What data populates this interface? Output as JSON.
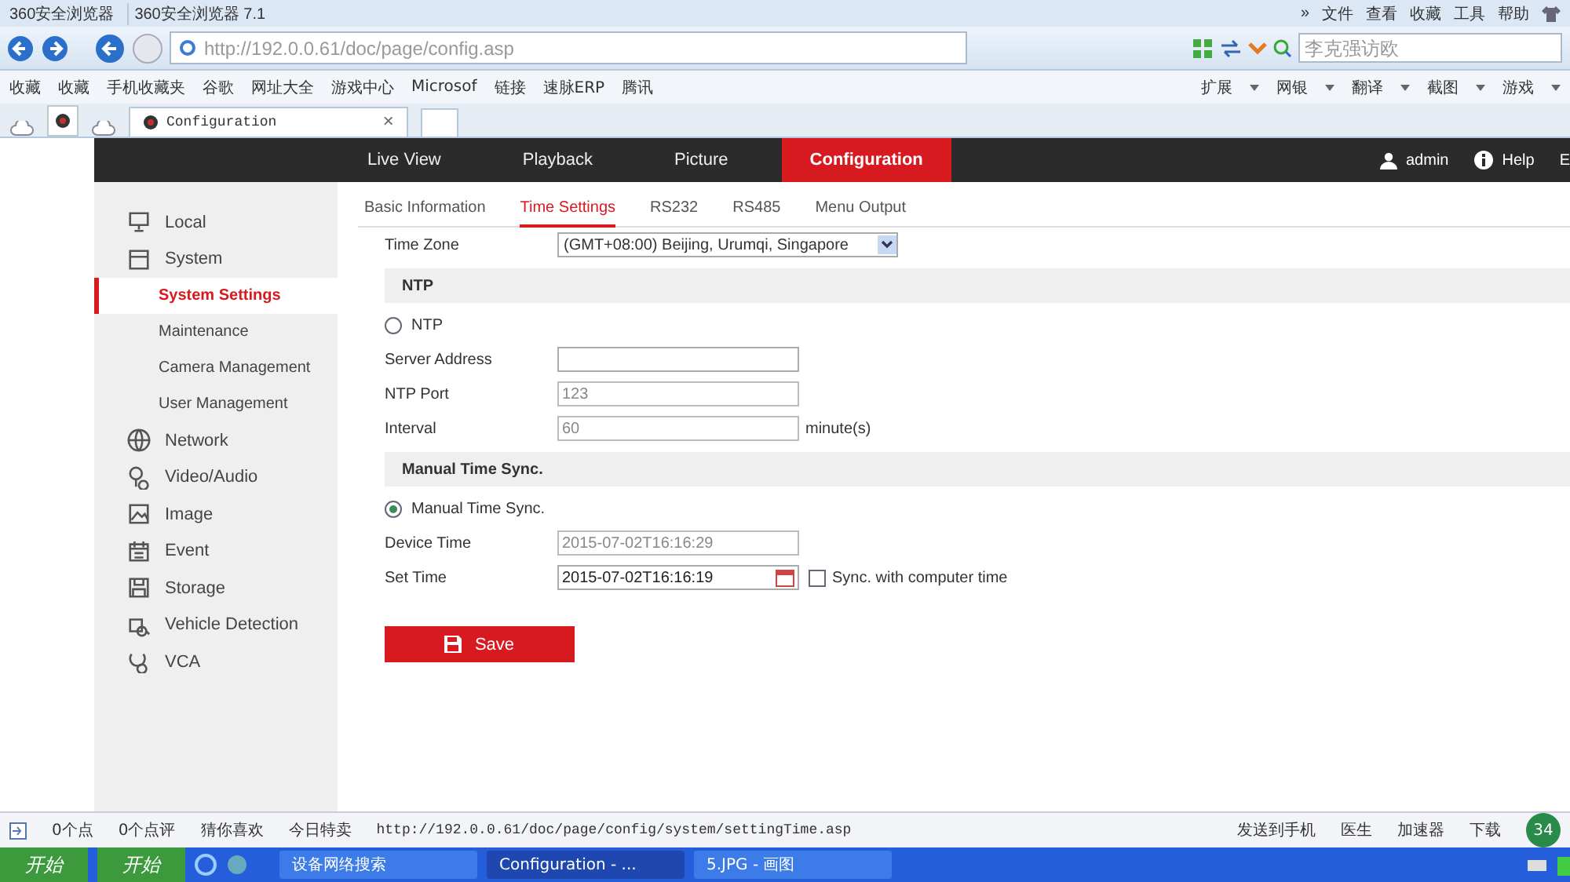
{
  "browser": {
    "back_title": "360安全浏览器",
    "title": "360安全浏览器 7.1",
    "menu": [
      "»",
      "文件",
      "查看",
      "收藏",
      "工具",
      "帮助"
    ],
    "url": "http://192.0.0.61/doc/page/config.asp",
    "search_placeholder": "李克强访欧",
    "bookmarks": [
      "收藏",
      "收藏",
      "手机收藏夹",
      "谷歌",
      "网址大全",
      "游戏中心",
      "Microsof",
      "链接",
      "速脉ERP",
      "腾讯"
    ],
    "tools": [
      "扩展",
      "网银",
      "翻译",
      "截图",
      "游戏"
    ],
    "tabs": [
      {
        "label": "Configuration",
        "selected": true
      }
    ],
    "close": "×"
  },
  "app": {
    "nav": [
      {
        "label": "Live View",
        "selected": false
      },
      {
        "label": "Playback",
        "selected": false
      },
      {
        "label": "Picture",
        "selected": false
      },
      {
        "label": "Configuration",
        "selected": true
      }
    ],
    "user": "admin",
    "help": "Help",
    "cut_item": "E",
    "sidebar": [
      {
        "label": "Local",
        "selected": false
      },
      {
        "label": "System",
        "selected": false,
        "children": [
          {
            "label": "System Settings",
            "selected": true
          },
          {
            "label": "Maintenance",
            "selected": false
          },
          {
            "label": "Camera Management",
            "selected": false
          },
          {
            "label": "User Management",
            "selected": false
          }
        ]
      },
      {
        "label": "Network",
        "selected": false
      },
      {
        "label": "Video/Audio",
        "selected": false
      },
      {
        "label": "Image",
        "selected": false
      },
      {
        "label": "Event",
        "selected": false
      },
      {
        "label": "Storage",
        "selected": false
      },
      {
        "label": "Vehicle Detection",
        "selected": false
      },
      {
        "label": "VCA",
        "selected": false
      }
    ],
    "tabs": [
      {
        "label": "Basic Information",
        "selected": false
      },
      {
        "label": "Time Settings",
        "selected": true
      },
      {
        "label": "RS232",
        "selected": false
      },
      {
        "label": "RS485",
        "selected": false
      },
      {
        "label": "Menu Output",
        "selected": false
      }
    ],
    "rows": [
      {
        "kind": "select",
        "label": "Time Zone",
        "value": "(GMT+08:00) Beijing, Urumqi, Singapore"
      },
      {
        "kind": "section",
        "label": "NTP"
      },
      {
        "kind": "radio",
        "label": "NTP",
        "selected": false
      },
      {
        "kind": "input",
        "label": "Server Address",
        "disabled": false
      },
      {
        "kind": "input",
        "label": "NTP Port",
        "value": "123",
        "disabled": true
      },
      {
        "kind": "input",
        "label": "Interval",
        "value": "60",
        "disabled": true,
        "unit": "minute(s)"
      },
      {
        "kind": "section",
        "label": "Manual Time Sync."
      },
      {
        "kind": "radio",
        "label": "Manual Time Sync.",
        "selected": true
      },
      {
        "kind": "input",
        "label": "Device Time",
        "value": "2015-07-02T16:16:29",
        "disabled": true
      },
      {
        "kind": "datetime",
        "label": "Set Time",
        "value": "2015-07-02T16:16:19",
        "check_label": "Sync. with computer time",
        "checked": false
      }
    ],
    "save": "Save"
  },
  "status_bar": {
    "left": [
      "0个点",
      "0个点评",
      "猜你喜欢",
      "今日特卖"
    ],
    "url": "http://192.0.0.61/doc/page/config/system/settingTime.asp",
    "right": [
      "发送到手机",
      "医生",
      "加速器",
      "下载"
    ],
    "badge": "34"
  },
  "taskbar": {
    "start": [
      "开始",
      "开始"
    ],
    "tasks": [
      {
        "label": "设备网络搜索",
        "selected": false
      },
      {
        "label": "Configuration - ...",
        "selected": true
      },
      {
        "label": "5.JPG - 画图",
        "selected": false
      }
    ]
  }
}
